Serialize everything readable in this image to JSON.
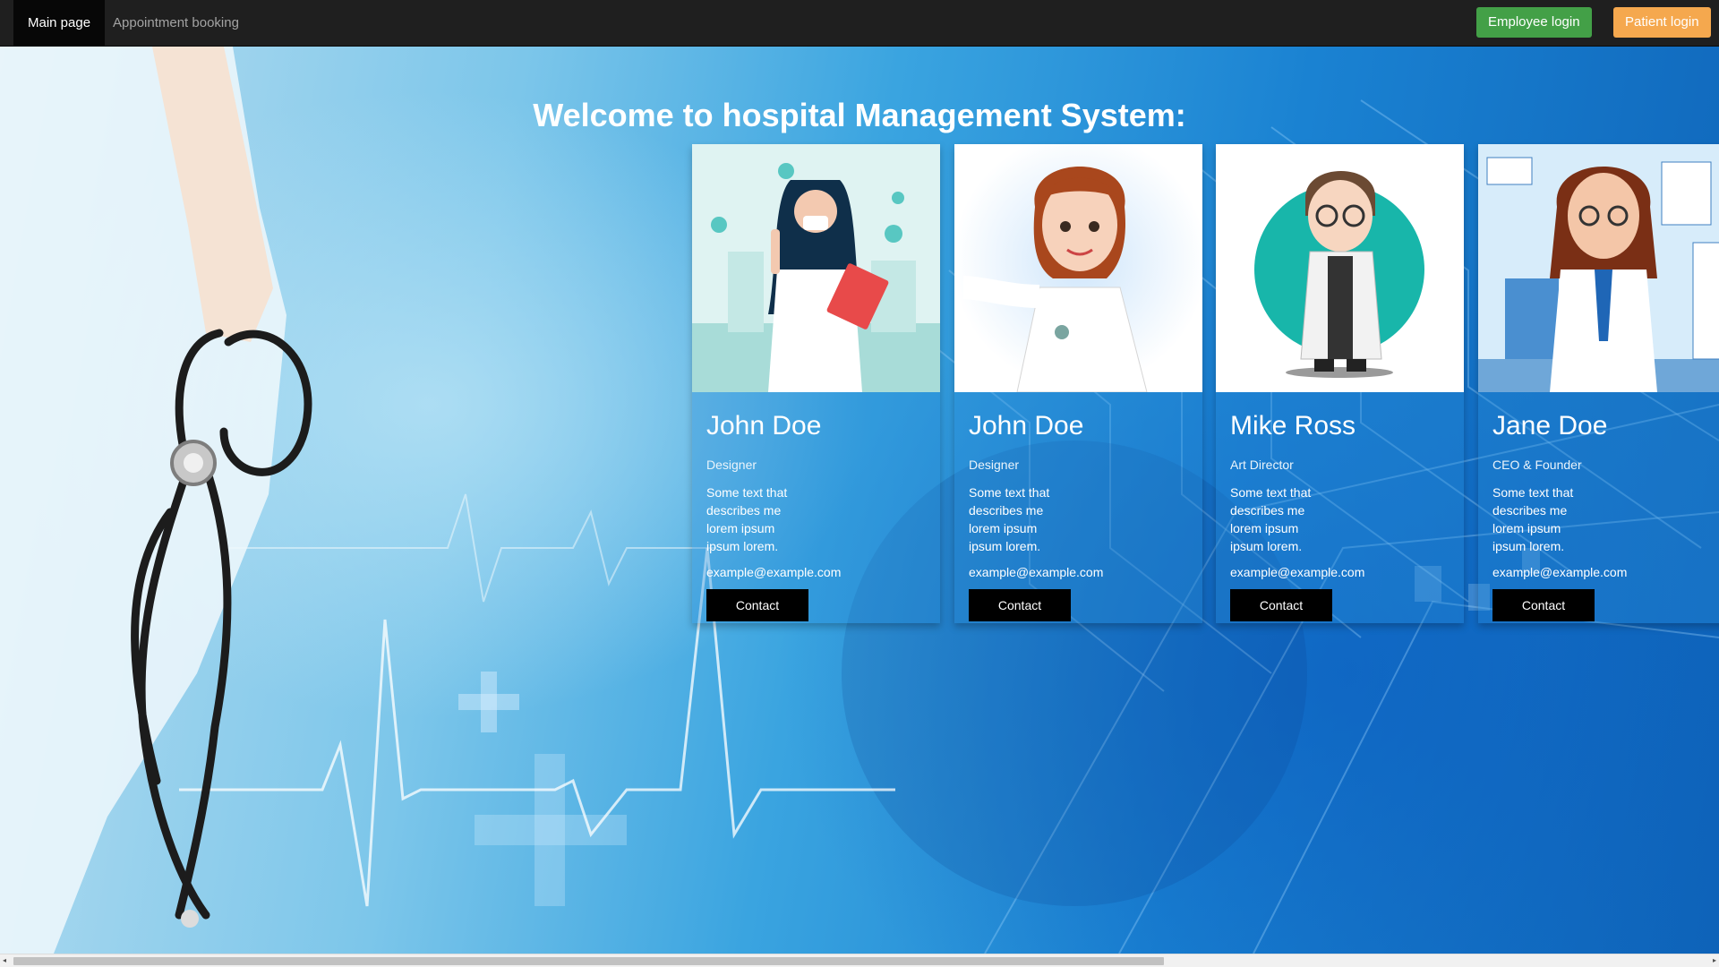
{
  "nav": {
    "items": [
      {
        "label": "Main page",
        "active": true
      },
      {
        "label": "Appointment booking",
        "active": false
      }
    ],
    "employee_login": "Employee login",
    "patient_login": "Patient login"
  },
  "hero": {
    "title": "Welcome to hospital Management System:"
  },
  "cards": [
    {
      "name": "John Doe",
      "role": "Designer",
      "description": "Some text that describes me lorem ipsum ipsum lorem.",
      "email": "example@example.com",
      "button": "Contact",
      "illustration": "masked-female-doctor-icon"
    },
    {
      "name": "John Doe",
      "role": "Designer",
      "description": "Some text that describes me lorem ipsum ipsum lorem.",
      "email": "example@example.com",
      "button": "Contact",
      "illustration": "female-doctor-presenting-icon"
    },
    {
      "name": "Mike Ross",
      "role": "Art Director",
      "description": "Some text that describes me lorem ipsum ipsum lorem.",
      "email": "example@example.com",
      "button": "Contact",
      "illustration": "male-doctor-glasses-icon"
    },
    {
      "name": "Jane Doe",
      "role": "CEO & Founder",
      "description": "Some text that describes me lorem ipsum ipsum lorem.",
      "email": "example@example.com",
      "button": "Contact",
      "illustration": "female-doctor-office-icon"
    }
  ],
  "colors": {
    "navbar": "#1f1f1f",
    "employee_button": "#43a047",
    "patient_button": "#f5a84e",
    "contact_button": "#000000",
    "background_blue": "#1a82d2"
  },
  "scrollbar": {
    "left_arrow": "◂",
    "right_arrow": "▸"
  }
}
